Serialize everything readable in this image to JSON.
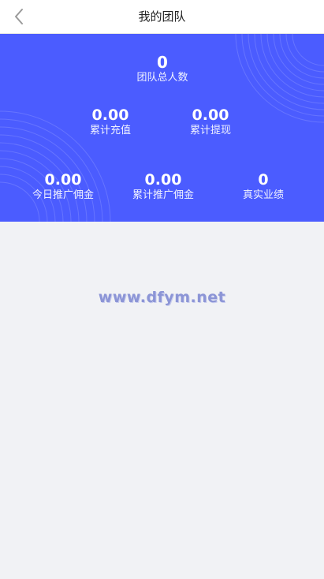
{
  "header": {
    "title": "我的团队",
    "back_icon": "chevron-left-icon"
  },
  "colors": {
    "hero_blue": "#4b5cff",
    "page_bg": "#f1f2f5"
  },
  "stats": {
    "total_members": {
      "value": "0",
      "label": "团队总人数"
    },
    "total_recharge": {
      "value": "0.00",
      "label": "累计充值"
    },
    "total_withdraw": {
      "value": "0.00",
      "label": "累计提现"
    },
    "today_commission": {
      "value": "0.00",
      "label": "今日推广佣金"
    },
    "total_commission": {
      "value": "0.00",
      "label": "累计推广佣金"
    },
    "real_performance": {
      "value": "0",
      "label": "真实业绩"
    }
  },
  "watermark": "www.dfym.net"
}
